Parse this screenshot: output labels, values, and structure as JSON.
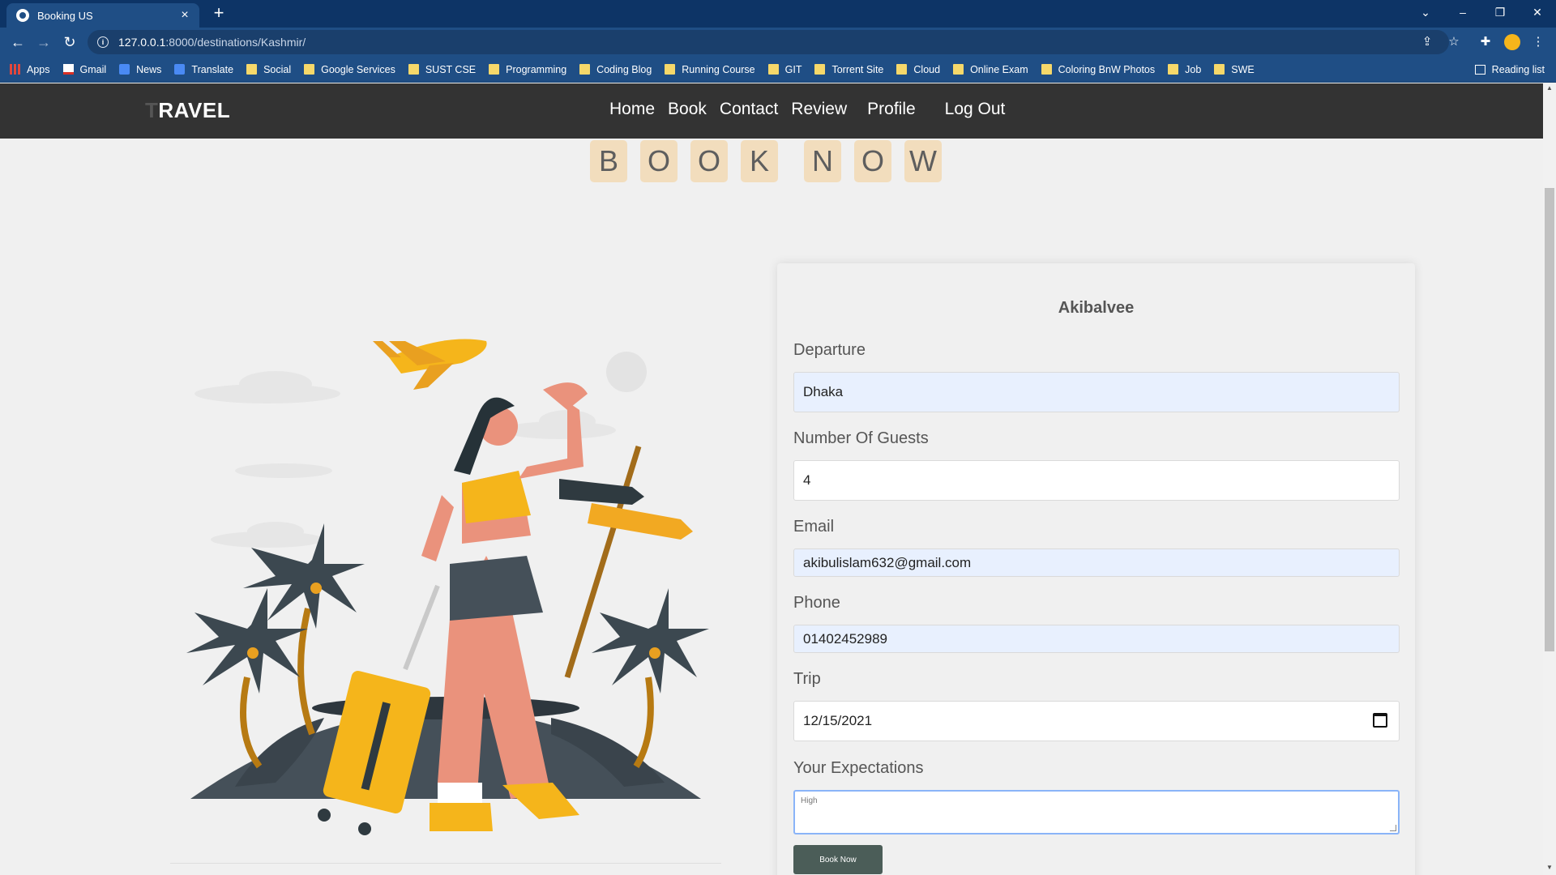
{
  "browser": {
    "tab_title": "Booking US",
    "url_host": "127.0.0.1",
    "url_path": ":8000/destinations/Kashmir/",
    "bookmarks": [
      "Apps",
      "Gmail",
      "News",
      "Translate",
      "Social",
      "Google Services",
      "SUST CSE",
      "Programming",
      "Coding Blog",
      "Running Course",
      "GIT",
      "Torrent Site",
      "Cloud",
      "Online Exam",
      "Coloring BnW Photos",
      "Job",
      "SWE"
    ],
    "reading_list": "Reading list"
  },
  "nav": {
    "logo_first": "T",
    "logo_rest": "RAVEL",
    "links": [
      "Home",
      "Book",
      "Contact",
      "Review",
      "Profile",
      "Log Out"
    ]
  },
  "hero": {
    "letters_1": [
      "B",
      "O",
      "O",
      "K"
    ],
    "letters_2": [
      "N",
      "O",
      "W"
    ]
  },
  "form": {
    "username": "Akibalvee",
    "departure_label": "Departure",
    "departure_value": "Dhaka",
    "guests_label": "Number Of Guests",
    "guests_value": "4",
    "email_label": "Email",
    "email_value": "akibulislam632@gmail.com",
    "phone_label": "Phone",
    "phone_value": "01402452989",
    "trip_label": "Trip",
    "trip_value": "12/15/2021",
    "expect_label": "Your Expectations",
    "expect_value": "High",
    "submit": "Book Now"
  },
  "colors": {
    "browser_frame": "#0d3466",
    "browser_toolbar": "#1f4e85",
    "site_nav": "#333333",
    "letter_tile": "#f2ddbd",
    "button": "#4b5d58",
    "autofill": "#e8f0fe"
  }
}
